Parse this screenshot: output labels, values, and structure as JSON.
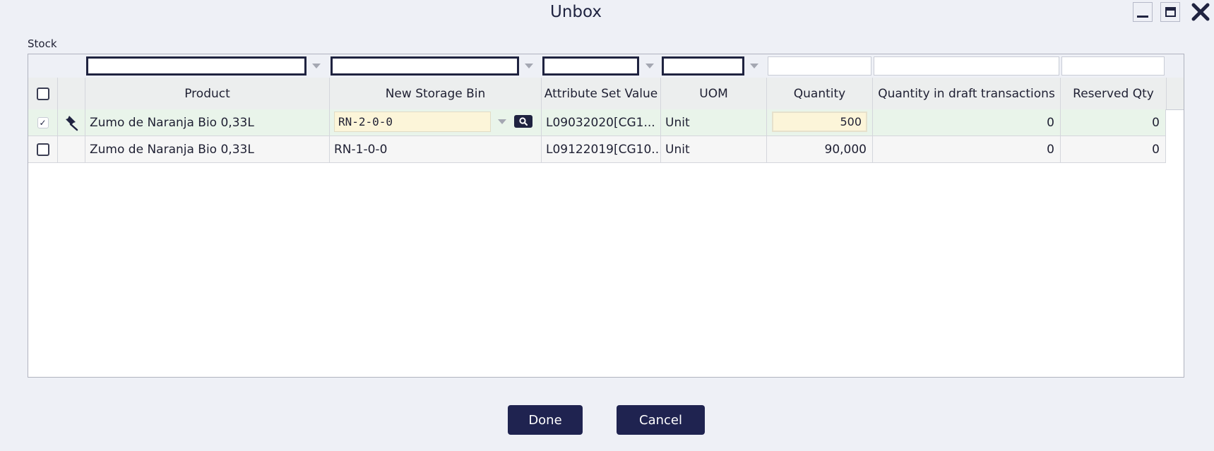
{
  "window": {
    "title": "Unbox"
  },
  "section_label": "Stock",
  "grid": {
    "columns": [
      "Product",
      "New Storage Bin",
      "Attribute Set Value",
      "UOM",
      "Quantity",
      "Quantity in draft transactions",
      "Reserved Qty"
    ],
    "rows": [
      {
        "selected": true,
        "product": "Zumo de Naranja Bio 0,33L",
        "bin": "RN-2-0-0",
        "attr": "L09032020[CG1...",
        "uom": "Unit",
        "qty": "500",
        "draft": "0",
        "reserved": "0"
      },
      {
        "selected": false,
        "product": "Zumo de Naranja Bio 0,33L",
        "bin": "RN-1-0-0",
        "attr": "L09122019[CG10...",
        "uom": "Unit",
        "qty": "90,000",
        "draft": "0",
        "reserved": "0"
      }
    ]
  },
  "buttons": {
    "done": "Done",
    "cancel": "Cancel"
  },
  "icons": {
    "row_pin": "pushpin-icon",
    "bin_search": "search-icon"
  }
}
